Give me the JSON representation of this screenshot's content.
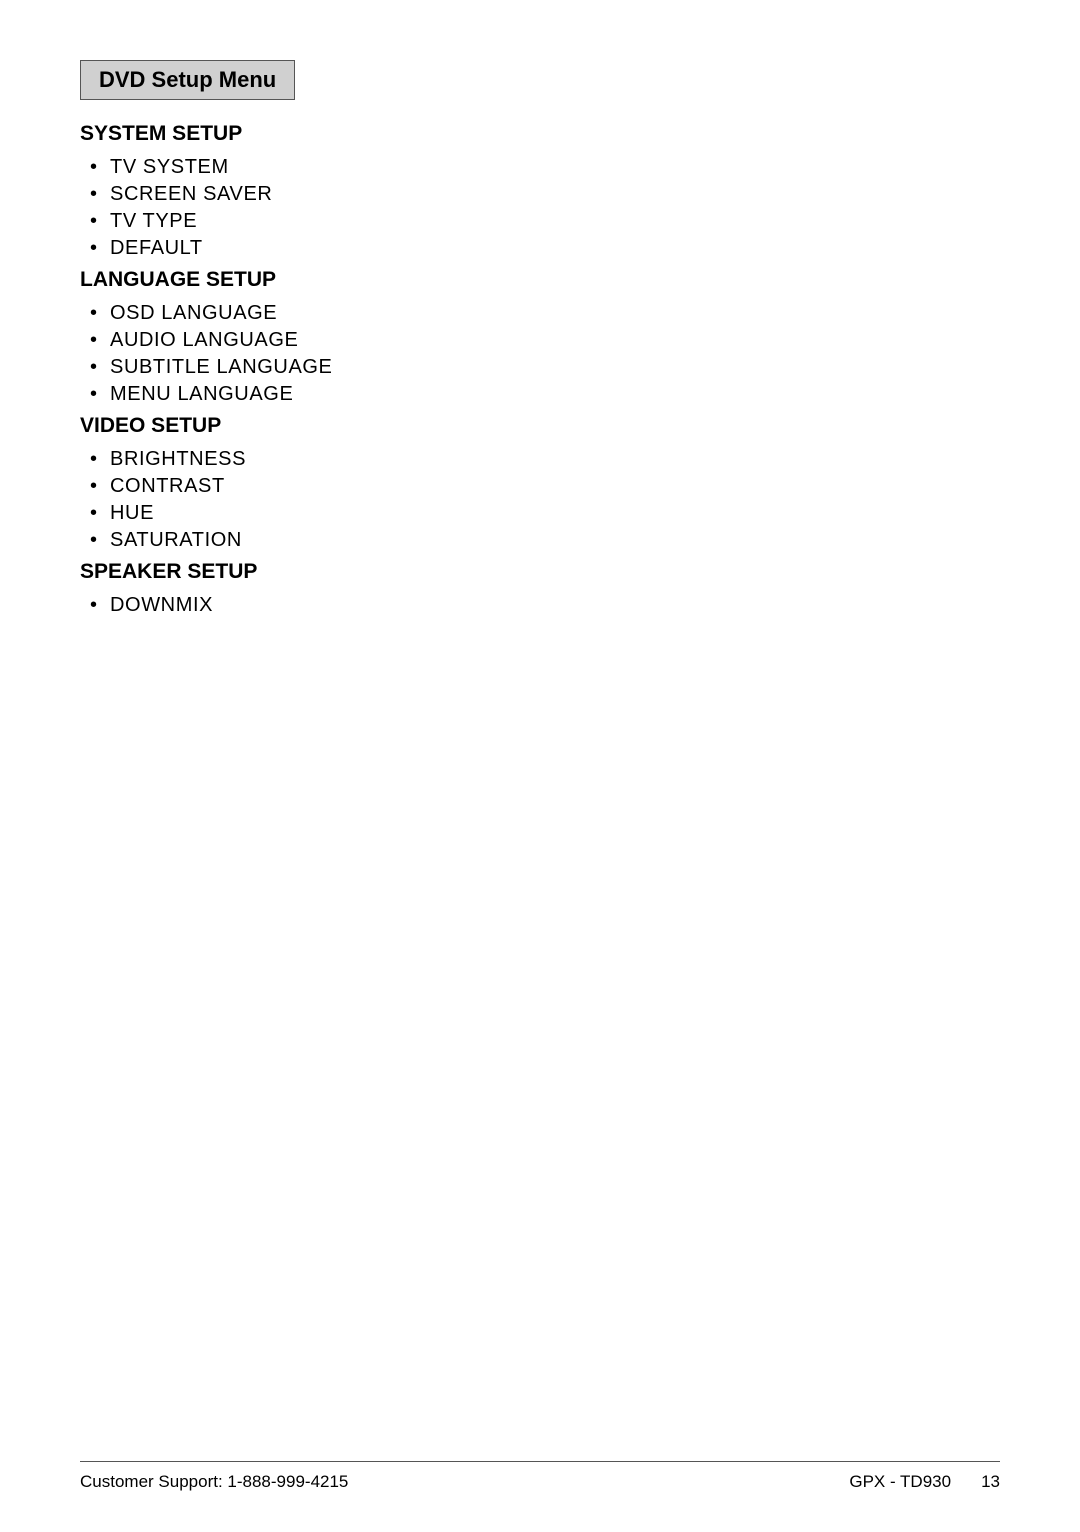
{
  "header": {
    "title": "DVD Setup Menu"
  },
  "sections": [
    {
      "id": "system-setup",
      "heading": "SYSTEM SETUP",
      "items": [
        "TV SYSTEM",
        "SCREEN SAVER",
        "TV TYPE",
        "DEFAULT"
      ]
    },
    {
      "id": "language-setup",
      "heading": "LANGUAGE SETUP",
      "items": [
        "OSD LANGUAGE",
        "AUDIO LANGUAGE",
        "SUBTITLE LANGUAGE",
        "MENU LANGUAGE"
      ]
    },
    {
      "id": "video-setup",
      "heading": "VIDEO SETUP",
      "items": [
        "BRIGHTNESS",
        "CONTRAST",
        "HUE",
        "SATURATION"
      ]
    },
    {
      "id": "speaker-setup",
      "heading": "SPEAKER SETUP",
      "items": [
        "DOWNMIX"
      ]
    }
  ],
  "footer": {
    "customer_support": "Customer Support: 1-888-999-4215",
    "model": "GPX - TD930",
    "page_number": "13"
  }
}
